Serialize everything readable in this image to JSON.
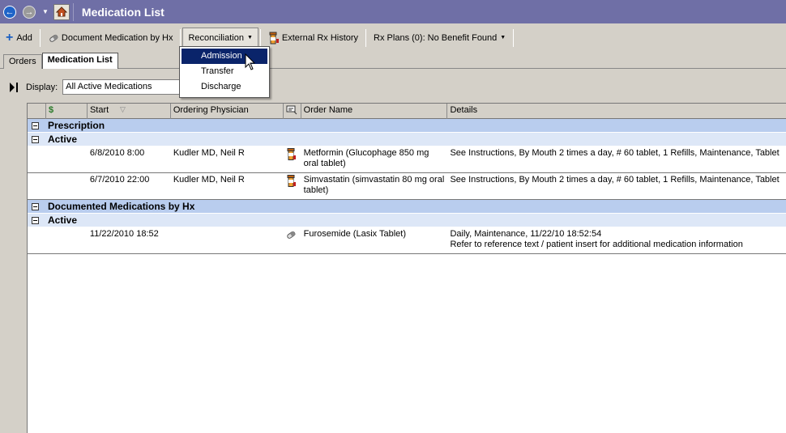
{
  "window": {
    "title": "Medication List"
  },
  "toolbar": {
    "add_label": "Add",
    "document_label": "Document Medication by Hx",
    "reconciliation_label": "Reconciliation",
    "external_label": "External Rx History",
    "rxplans_label": "Rx Plans (0): No Benefit Found"
  },
  "tabs": [
    {
      "label": "Orders"
    },
    {
      "label": "Medication List"
    }
  ],
  "display": {
    "label": "Display:",
    "value": "All Active Medications"
  },
  "menu": {
    "items": [
      {
        "label": "Admission"
      },
      {
        "label": "Transfer"
      },
      {
        "label": "Discharge"
      }
    ]
  },
  "grid": {
    "columns": {
      "cost": "$",
      "start": "Start",
      "physician": "Ordering Physician",
      "order": "Order Name",
      "details": "Details"
    },
    "groups": [
      {
        "label": "Prescription",
        "sublabel": "Active",
        "rows": [
          {
            "start": "6/8/2010 8:00",
            "physician": "Kudler MD, Neil R",
            "icon": "pill-bottle-icon",
            "order": "Metformin (Glucophage 850 mg oral tablet)",
            "details": "See Instructions, By Mouth 2 times a day, # 60 tablet, 1 Refills, Maintenance, Tablet"
          },
          {
            "start": "6/7/2010 22:00",
            "physician": "Kudler MD, Neil R",
            "icon": "pill-bottle-icon",
            "order": "Simvastatin (simvastatin 80 mg oral tablet)",
            "details": "See Instructions, By Mouth 2 times a day, # 60 tablet, 1 Refills, Maintenance, Tablet"
          }
        ]
      },
      {
        "label": "Documented Medications by Hx",
        "sublabel": "Active",
        "rows": [
          {
            "start": "11/22/2010 18:52",
            "physician": "",
            "icon": "capsule-icon",
            "order": "Furosemide (Lasix Tablet)",
            "details": "Daily, Maintenance, 11/22/10 18:52:54",
            "details2": "Refer to reference text / patient insert for additional medication information"
          }
        ]
      }
    ]
  }
}
